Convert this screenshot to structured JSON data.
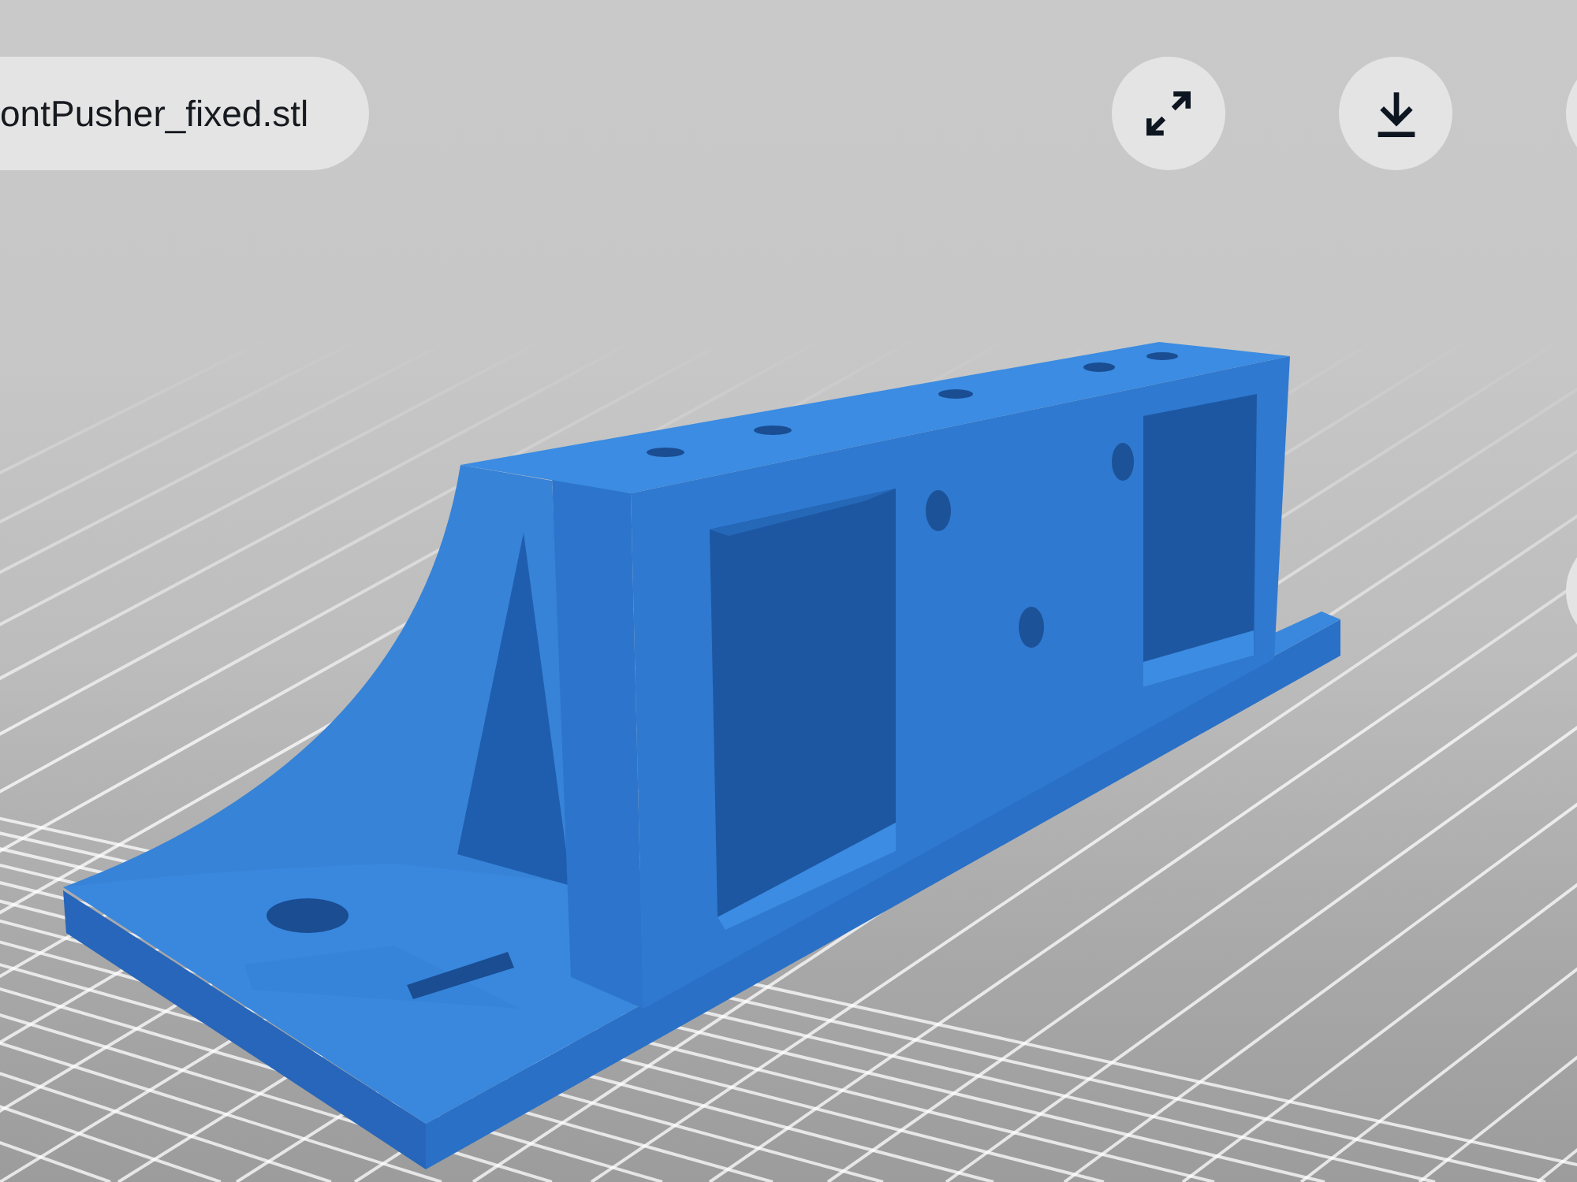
{
  "file_name": "ontPusher_fixed.stl",
  "toolbar": {
    "buttons": [
      {
        "kind": "expand"
      },
      {
        "kind": "download"
      },
      {
        "kind": "partial"
      }
    ]
  }
}
